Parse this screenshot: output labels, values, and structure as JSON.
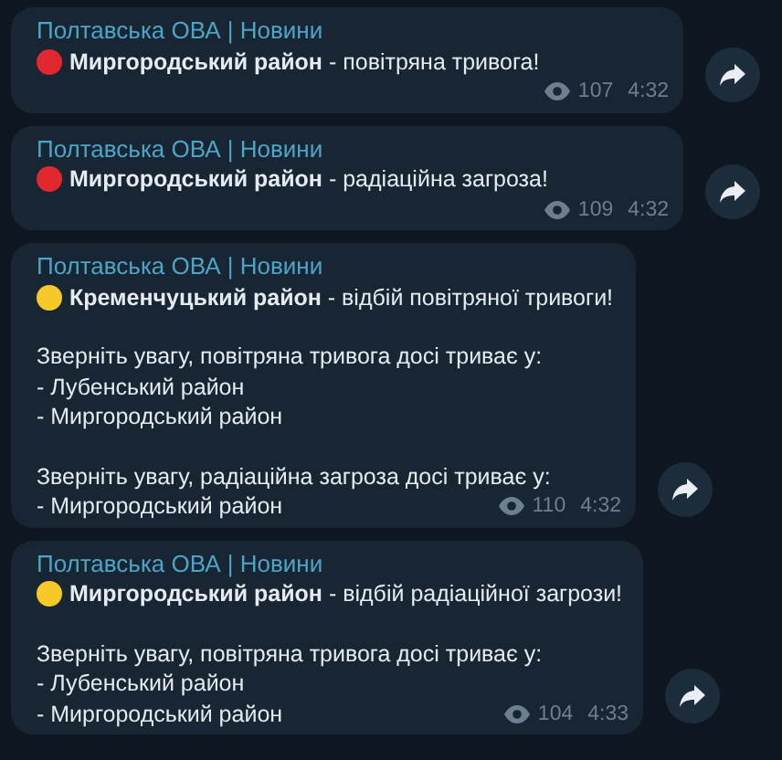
{
  "messages": [
    {
      "sender": "Полтавська ОВА | Новини",
      "color": "#e0282e",
      "headline": "**Миргородський район** - повітряна тривога!",
      "views": "107",
      "time": "4:32"
    },
    {
      "sender": "Полтавська ОВА | Новини",
      "color": "#e0282e",
      "headline": "**Миргородський район** - радіаційна загроза!",
      "views": "109",
      "time": "4:32"
    },
    {
      "sender": "Полтавська ОВА | Новини",
      "color": "#f6c928",
      "headline": "**Кременчуцький район** - відбій повітряної тривоги!",
      "paragraphs": [
        [
          "Зверніть увагу, повітряна тривога досі триває у:",
          "- Лубенський район",
          "- Миргородський район"
        ],
        [
          "Зверніть увагу, радіаційна загроза досі триває у:",
          "- Миргородський район"
        ]
      ],
      "views": "110",
      "time": "4:32"
    },
    {
      "sender": "Полтавська ОВА | Новини",
      "color": "#f6c928",
      "headline": "**Миргородський район** - відбій радіаційної загрози!",
      "paragraphs": [
        [
          "Зверніть увагу, повітряна тривога досі триває у:",
          "- Лубенський район",
          "- Миргородський район"
        ]
      ],
      "views": "104",
      "time": "4:33"
    }
  ]
}
